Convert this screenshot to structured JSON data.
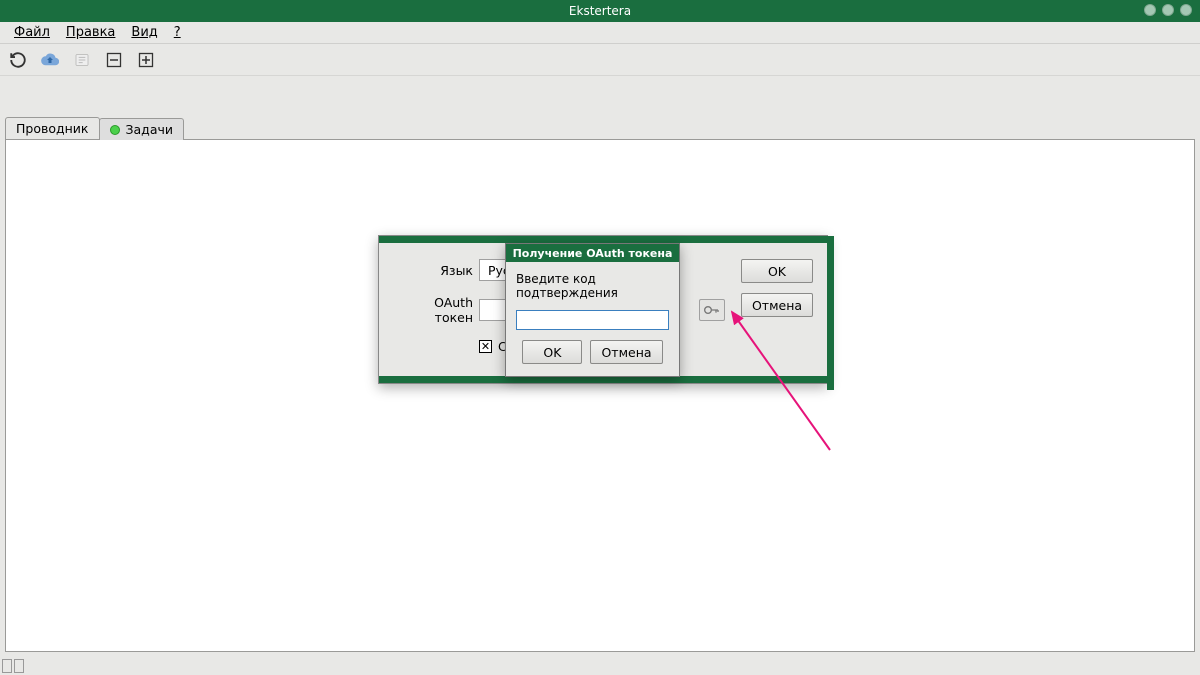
{
  "window": {
    "title": "Ekstertera"
  },
  "menu": {
    "file": "Файл",
    "edit": "Правка",
    "view": "Вид",
    "help": "?"
  },
  "tabs": {
    "explorer": "Проводник",
    "tasks": "Задачи"
  },
  "settings_dialog": {
    "language_label": "Язык",
    "language_value": "Русский",
    "token_label": "OAuth токен",
    "token_value": "",
    "hide_checkbox_label": "Скрыват",
    "ok": "OK",
    "cancel": "Отмена"
  },
  "oauth_dialog": {
    "title": "Получение OAuth токена",
    "prompt": "Введите код подтверждения",
    "code_value": "",
    "ok": "OK",
    "cancel": "Отмена"
  },
  "colors": {
    "accent": "#1a6e3f",
    "arrow": "#e6137a"
  }
}
